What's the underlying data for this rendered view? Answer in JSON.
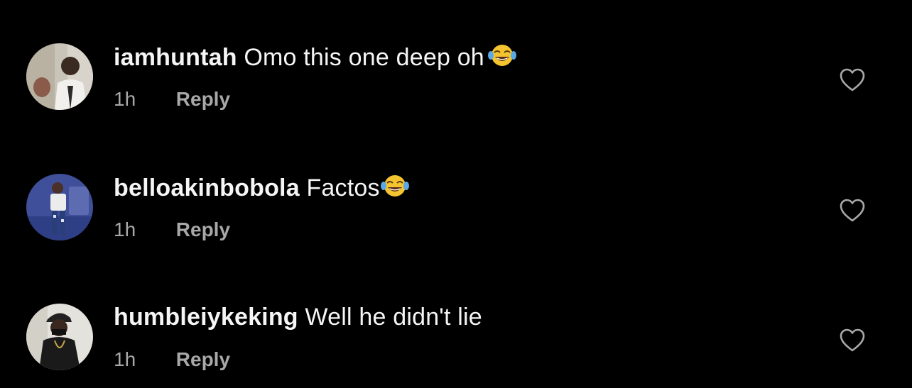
{
  "comments": [
    {
      "username": "iamhuntah",
      "text": "Omo this one deep oh",
      "emoji": "tears-of-joy",
      "time": "1h",
      "reply_label": "Reply"
    },
    {
      "username": "belloakinbobola",
      "text": "Factos",
      "emoji": "tears-of-joy",
      "time": "1h",
      "reply_label": "Reply"
    },
    {
      "username": "humbleiykeking",
      "text": "Well he didn't lie",
      "time": "1h",
      "reply_label": "Reply"
    }
  ],
  "colors": {
    "background": "#000000",
    "primary_text": "#f5f5f5",
    "secondary_text": "#a8a8a8"
  }
}
